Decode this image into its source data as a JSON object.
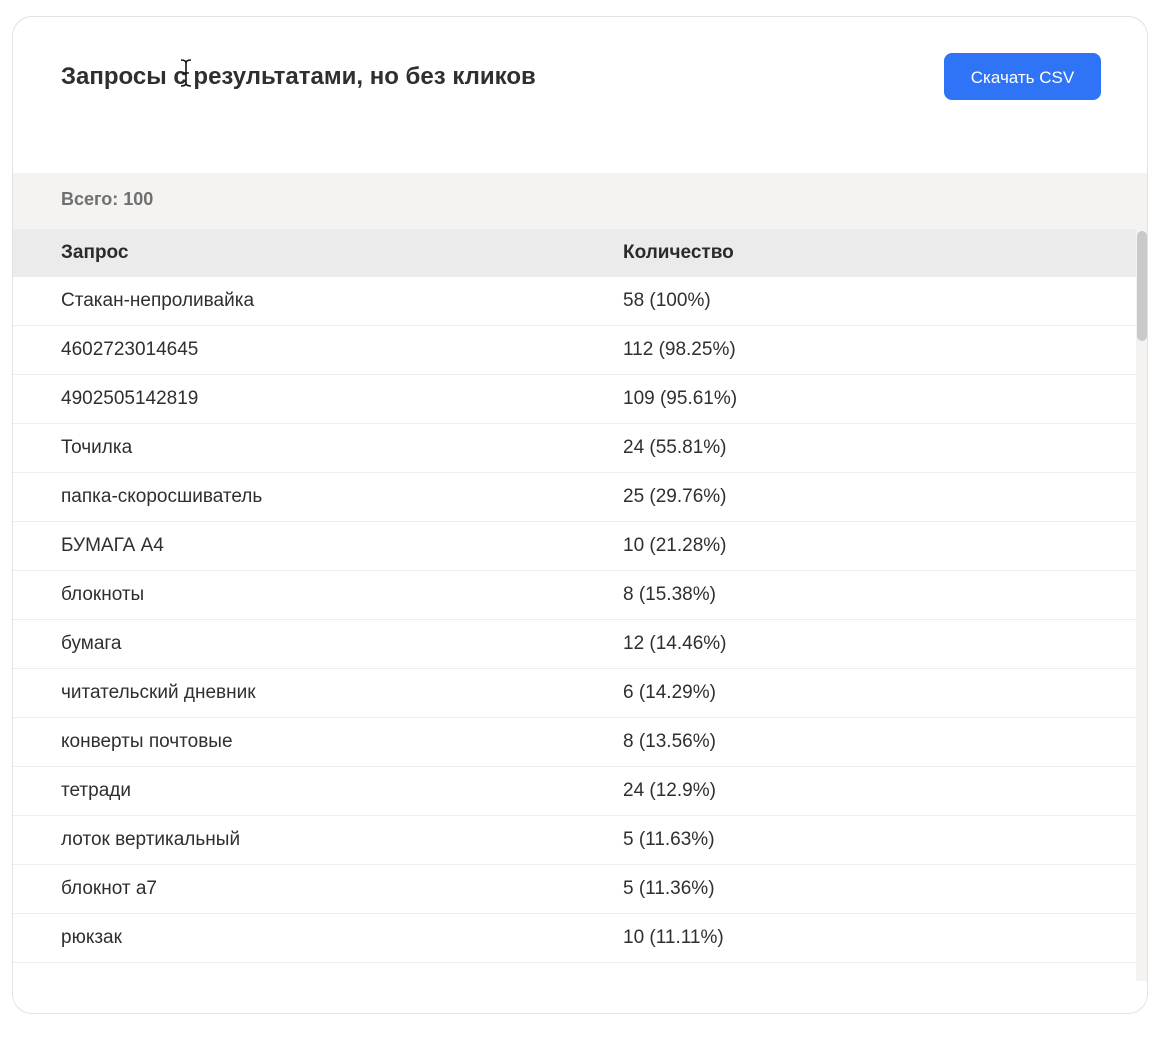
{
  "header": {
    "title": "Запросы с результатами, но без кликов",
    "download_label": "Скачать CSV"
  },
  "summary": {
    "total_text": "Всего: 100"
  },
  "table": {
    "columns": [
      "Запрос",
      "Количество"
    ],
    "rows": [
      {
        "query": "Стакан-непроливайка",
        "count": "58 (100%)"
      },
      {
        "query": "4602723014645",
        "count": "112 (98.25%)"
      },
      {
        "query": "4902505142819",
        "count": "109 (95.61%)"
      },
      {
        "query": "Точилка",
        "count": "24 (55.81%)"
      },
      {
        "query": "папка-скоросшиватель",
        "count": "25 (29.76%)"
      },
      {
        "query": "БУМАГА А4",
        "count": "10 (21.28%)"
      },
      {
        "query": "блокноты",
        "count": "8 (15.38%)"
      },
      {
        "query": "бумага",
        "count": "12 (14.46%)"
      },
      {
        "query": "читательский дневник",
        "count": "6 (14.29%)"
      },
      {
        "query": "конверты почтовые",
        "count": "8 (13.56%)"
      },
      {
        "query": "тетради",
        "count": "24 (12.9%)"
      },
      {
        "query": "лоток вертикальный",
        "count": "5 (11.63%)"
      },
      {
        "query": "блокнот а7",
        "count": "5 (11.36%)"
      },
      {
        "query": "рюкзак",
        "count": "10 (11.11%)"
      }
    ]
  },
  "colors": {
    "accent": "#2f74f6",
    "band": "#f4f3f1",
    "table_header": "#ebebeb"
  },
  "icons": {
    "cursor": "text-cursor-icon"
  }
}
